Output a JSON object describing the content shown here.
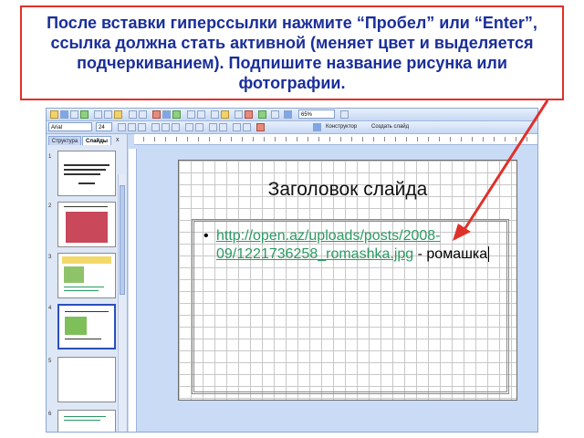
{
  "callout": {
    "text": "После вставки гиперссылки нажмите “Пробел” или “Enter”, ссылка должна стать активной (меняет цвет и выделяется подчеркиванием). Подпишите название рисунка или фотографии."
  },
  "toolbar": {
    "zoom": "65%",
    "font": "Arial",
    "size": "24",
    "designer": "Конструктор",
    "create_slide": "Создать слайд"
  },
  "panel": {
    "tab_structure": "Структура",
    "tab_slides": "Слайды",
    "close": "x",
    "slide_numbers": [
      "1",
      "2",
      "3",
      "4",
      "5",
      "6"
    ]
  },
  "slide": {
    "title": "Заголовок слайда",
    "bullet": "•",
    "link_text": "http://open.az/uploads/posts/2008-09/1221736258_romashka.jpg",
    "suffix": " - ромашка"
  },
  "colors": {
    "callout_border": "#e0302a",
    "callout_text": "#1a2e9a",
    "link": "#2a9a62",
    "arrow": "#e0302a"
  }
}
